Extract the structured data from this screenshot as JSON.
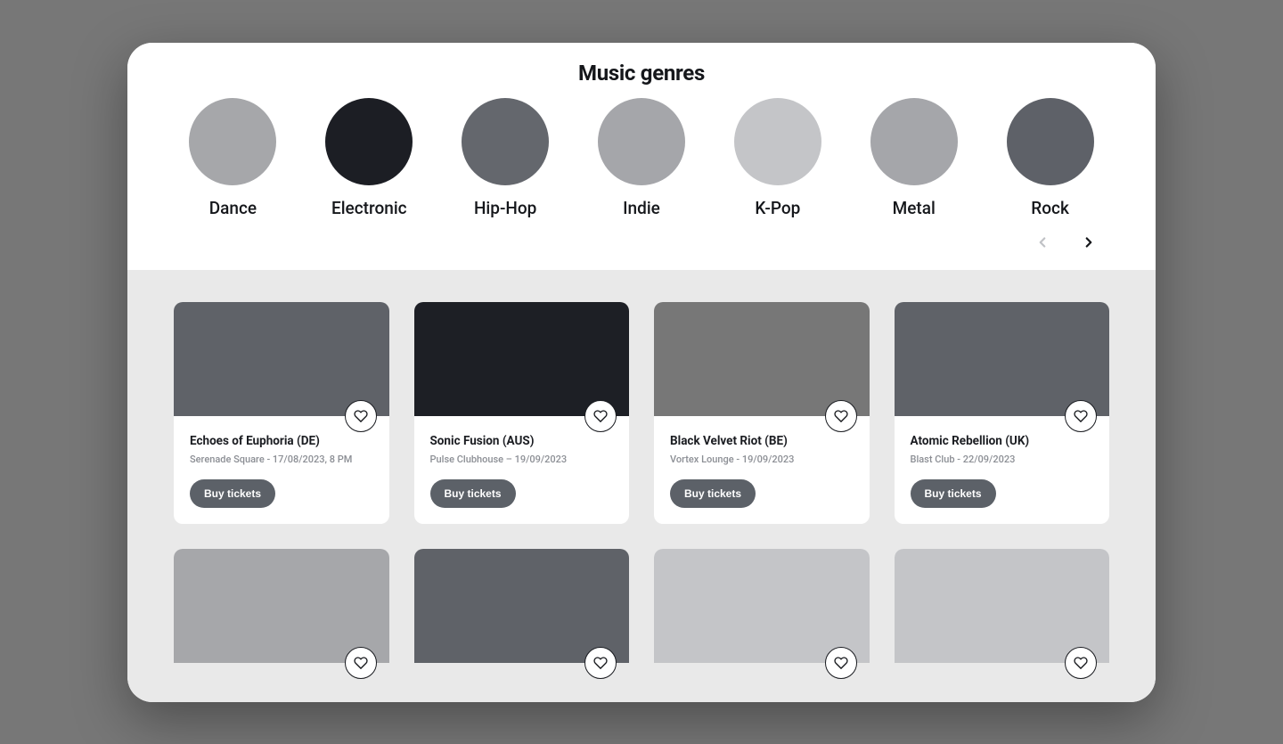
{
  "title": "Music genres",
  "genres": [
    {
      "label": "Dance",
      "color": "#a6a7aa"
    },
    {
      "label": "Electronic",
      "color": "#1c1e24"
    },
    {
      "label": "Hip-Hop",
      "color": "#64676d"
    },
    {
      "label": "Indie",
      "color": "#a5a6aa"
    },
    {
      "label": "K-Pop",
      "color": "#c4c5c8"
    },
    {
      "label": "Metal",
      "color": "#a5a6aa"
    },
    {
      "label": "Rock",
      "color": "#5e6168"
    }
  ],
  "nav": {
    "prev_enabled": false,
    "next_enabled": true
  },
  "buy_label": "Buy tickets",
  "events": [
    {
      "title": "Echoes of Euphoria (DE)",
      "meta": "Serenade Square - 17/08/2023, 8 PM",
      "image_color": "#5f6268"
    },
    {
      "title": "Sonic Fusion (AUS)",
      "meta": "Pulse Clubhouse – 19/09/2023",
      "image_color": "#1d1f25"
    },
    {
      "title": "Black Velvet Riot (BE)",
      "meta": "Vortex Lounge - 19/09/2023",
      "image_color": "#777777"
    },
    {
      "title": "Atomic Rebellion (UK)",
      "meta": "Blast Club - 22/09/2023",
      "image_color": "#5f6268"
    },
    {
      "title": "",
      "meta": "",
      "image_color": "#a6a7aa"
    },
    {
      "title": "",
      "meta": "",
      "image_color": "#5f6268"
    },
    {
      "title": "",
      "meta": "",
      "image_color": "#c4c5c8"
    },
    {
      "title": "",
      "meta": "",
      "image_color": "#c4c5c8"
    }
  ]
}
